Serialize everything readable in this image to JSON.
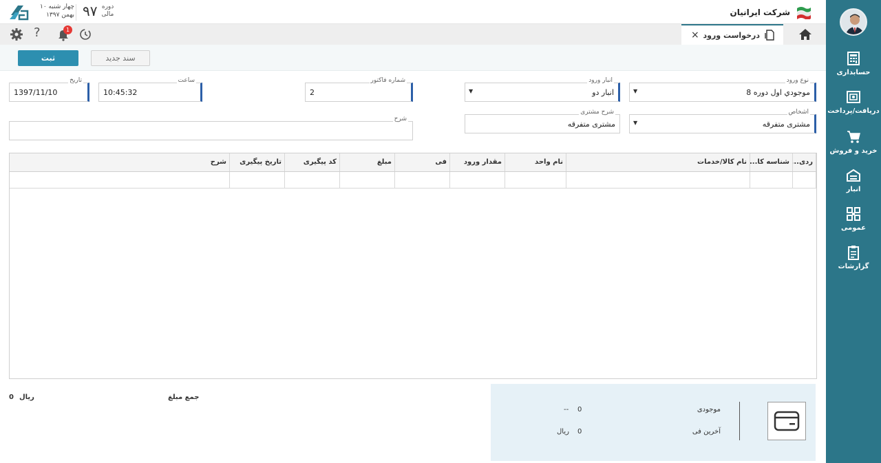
{
  "header": {
    "company_name": "شرکت ایرانیان",
    "period_number": "۹۷",
    "period_label_1": "دوره",
    "period_label_2": "مالی",
    "weekday": "چهار شنبه ۱۰",
    "month_year": "بهمن ۱۳۹۷"
  },
  "tabs": {
    "active_tab_label": "درخواست ورود",
    "close_glyph": "×",
    "notification_count": "1"
  },
  "toolbar": {
    "save_label": "ثبت",
    "new_doc_label": "سند جدید"
  },
  "form": {
    "entry_type_label": "نوع ورود",
    "entry_type_value": "8 موجودي اول دوره",
    "warehouse_label": "انبار ورود",
    "warehouse_value": "انبار دو",
    "invoice_label": "شماره فاکتور",
    "invoice_value": "2",
    "time_label": "ساعت",
    "time_value": "10:45:32",
    "date_label": "تاریخ",
    "date_value": "1397/11/10",
    "person_label": "اشخاص",
    "person_value": "مشتری متفرقه",
    "customer_desc_label": "شرح مشتری",
    "customer_desc_value": "مشتری متفرقه",
    "description_label": "شرح",
    "description_value": ""
  },
  "grid": {
    "columns": [
      "ردی...",
      "شناسه کا...",
      "نام کالا/خدمات",
      "نام واحد",
      "مقدار ورود",
      "فی",
      "مبلغ",
      "کد پیگیری",
      "تاریخ پیگیری",
      "شرح"
    ]
  },
  "footer": {
    "total_label": "جمع مبلغ",
    "total_value": "0",
    "total_currency": "ریال",
    "stock_label": "موجودی",
    "stock_value": "0",
    "stock_unit": "--",
    "last_price_label": "آخرین فی",
    "last_price_value": "0",
    "last_price_currency": "ریال"
  },
  "sidebar": {
    "items": [
      {
        "label": "حسابداری",
        "icon": "accounting-icon"
      },
      {
        "label": "دریافت/پرداخت",
        "icon": "safe-icon"
      },
      {
        "label": "خرید و فروش",
        "icon": "cart-icon"
      },
      {
        "label": "انبار",
        "icon": "warehouse-icon"
      },
      {
        "label": "عمومی",
        "icon": "grid-icon"
      },
      {
        "label": "گزارشات",
        "icon": "clipboard-icon"
      }
    ]
  },
  "colors": {
    "sidebar_bg": "#2c7689",
    "primary_button": "#2d8fb0",
    "field_accent": "#2c5fa8",
    "notification_badge": "#e53935"
  }
}
